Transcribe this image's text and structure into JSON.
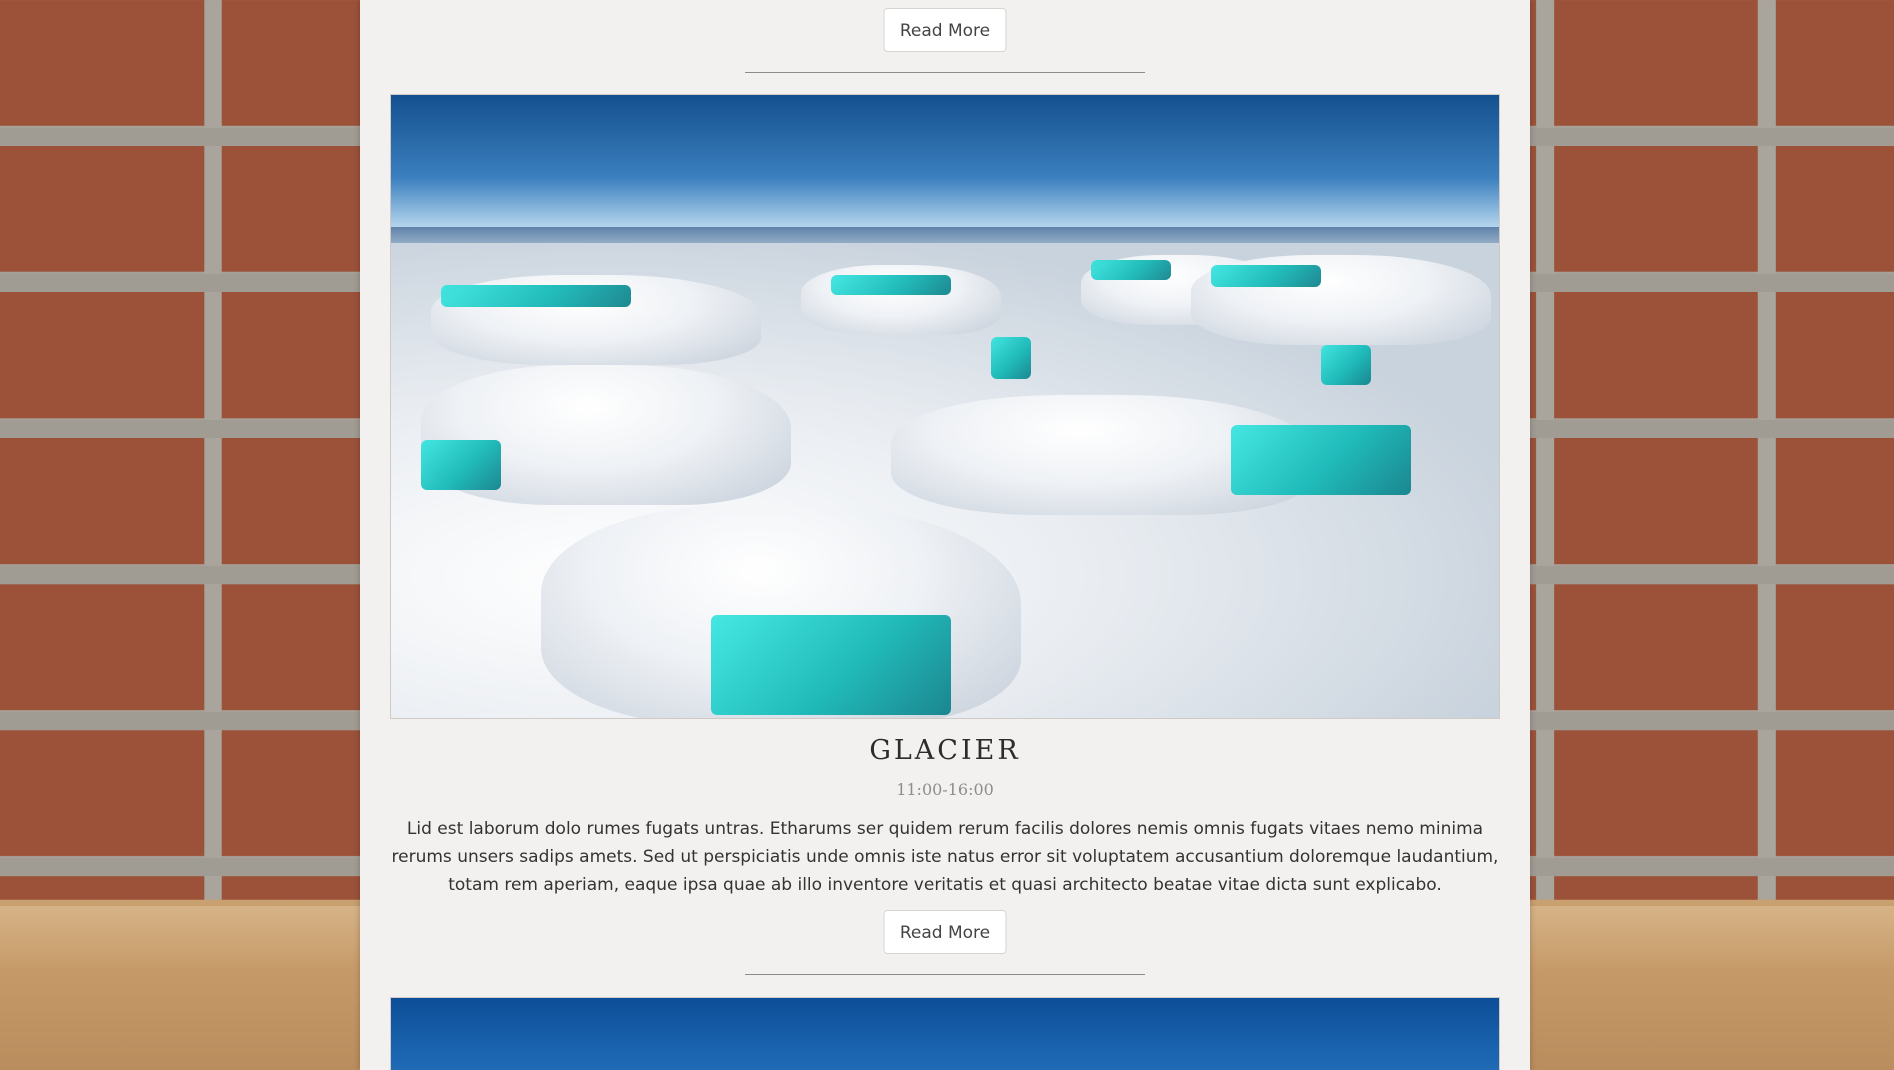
{
  "posts": [
    {
      "read_more_label": "Read More"
    },
    {
      "title": "GLACIER",
      "time": "11:00-16:00",
      "description": "Lid est laborum dolo rumes fugats untras. Etharums ser quidem rerum facilis dolores nemis omnis fugats vitaes nemo minima rerums unsers sadips amets. Sed ut perspiciatis unde omnis iste natus error sit voluptatem accusantium doloremque laudantium, totam rem aperiam, eaque ipsa quae ab illo inventore veritatis et quasi architecto beatae vitae dicta sunt explicabo.",
      "read_more_label": "Read More",
      "image_alt": "glacier-photo"
    }
  ],
  "colors": {
    "panel_bg": "#f3f1ef",
    "button_bg": "#ffffff",
    "text": "#333333",
    "muted": "#8d8d8d"
  }
}
